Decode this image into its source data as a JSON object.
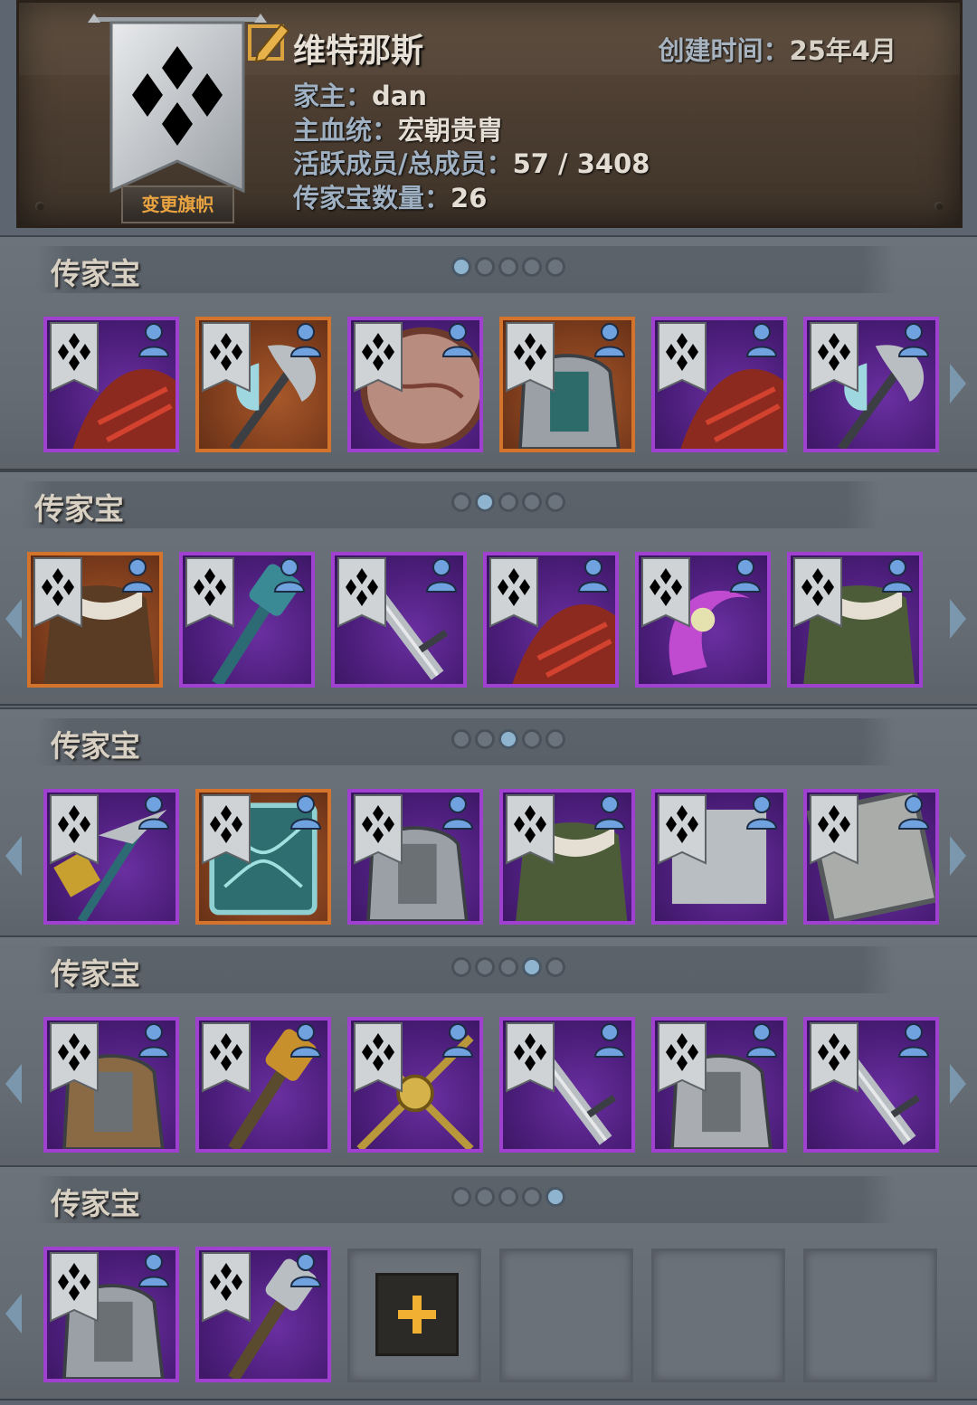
{
  "header": {
    "family_name": "维特那斯",
    "created_label": "创建时间：",
    "created_value": "25年4月",
    "banner_button": "变更旗帜",
    "head_label": "家主：",
    "head_value": "dan",
    "bloodline_label": "主血统：",
    "bloodline_value": "宏朝贵胄",
    "members_label": "活跃成员/总成员：",
    "members_value": "57 / 3408",
    "heirloom_count_label": "传家宝数量：",
    "heirloom_count_value": "26"
  },
  "sections": [
    {
      "title": "传家宝",
      "page": 1,
      "pages": 5,
      "items": [
        {
          "name": "red-wing-cloak",
          "rarity": "purple"
        },
        {
          "name": "crystal-axe",
          "rarity": "orange"
        },
        {
          "name": "flesh-shield",
          "rarity": "purple"
        },
        {
          "name": "lion-plate-armor",
          "rarity": "orange"
        },
        {
          "name": "red-wing-cloak",
          "rarity": "purple"
        },
        {
          "name": "skull-battle-axe",
          "rarity": "purple"
        }
      ]
    },
    {
      "title": "传家宝",
      "page": 2,
      "pages": 5,
      "items": [
        {
          "name": "fur-coat",
          "rarity": "orange"
        },
        {
          "name": "teal-mace",
          "rarity": "purple"
        },
        {
          "name": "steel-blade",
          "rarity": "purple"
        },
        {
          "name": "red-wing-cloak",
          "rarity": "purple"
        },
        {
          "name": "pink-scythe",
          "rarity": "purple"
        },
        {
          "name": "green-fur-tunic",
          "rarity": "purple"
        }
      ]
    },
    {
      "title": "传家宝",
      "page": 3,
      "pages": 5,
      "items": [
        {
          "name": "war-pick",
          "rarity": "purple"
        },
        {
          "name": "jade-tower-shield",
          "rarity": "orange"
        },
        {
          "name": "steel-plate-armor",
          "rarity": "purple"
        },
        {
          "name": "green-fur-tunic",
          "rarity": "purple"
        },
        {
          "name": "longbow",
          "rarity": "purple"
        },
        {
          "name": "iron-tower-shield",
          "rarity": "purple"
        }
      ]
    },
    {
      "title": "传家宝",
      "page": 4,
      "pages": 5,
      "items": [
        {
          "name": "leather-armor",
          "rarity": "purple"
        },
        {
          "name": "golden-mace",
          "rarity": "purple"
        },
        {
          "name": "golden-crossed-staff",
          "rarity": "purple"
        },
        {
          "name": "serrated-sword",
          "rarity": "purple"
        },
        {
          "name": "chainmail-armor",
          "rarity": "purple"
        },
        {
          "name": "long-sword",
          "rarity": "purple"
        }
      ]
    },
    {
      "title": "传家宝",
      "page": 5,
      "pages": 5,
      "items": [
        {
          "name": "steel-plate-armor",
          "rarity": "purple"
        },
        {
          "name": "war-hammer",
          "rarity": "purple"
        }
      ],
      "add_slot": "add-heirloom",
      "empty_slots": 3
    }
  ],
  "icons": {
    "banner": "family-banner-icon",
    "edit": "edit-name-icon",
    "owner": "person-icon",
    "add": "plus-icon",
    "next": "chevron-right-icon",
    "prev": "chevron-left-icon"
  },
  "colors": {
    "rarity_purple": "#a040d0",
    "rarity_orange": "#d4742c",
    "accent_gold": "#e9a441",
    "dot_active": "#8fb4cf"
  }
}
